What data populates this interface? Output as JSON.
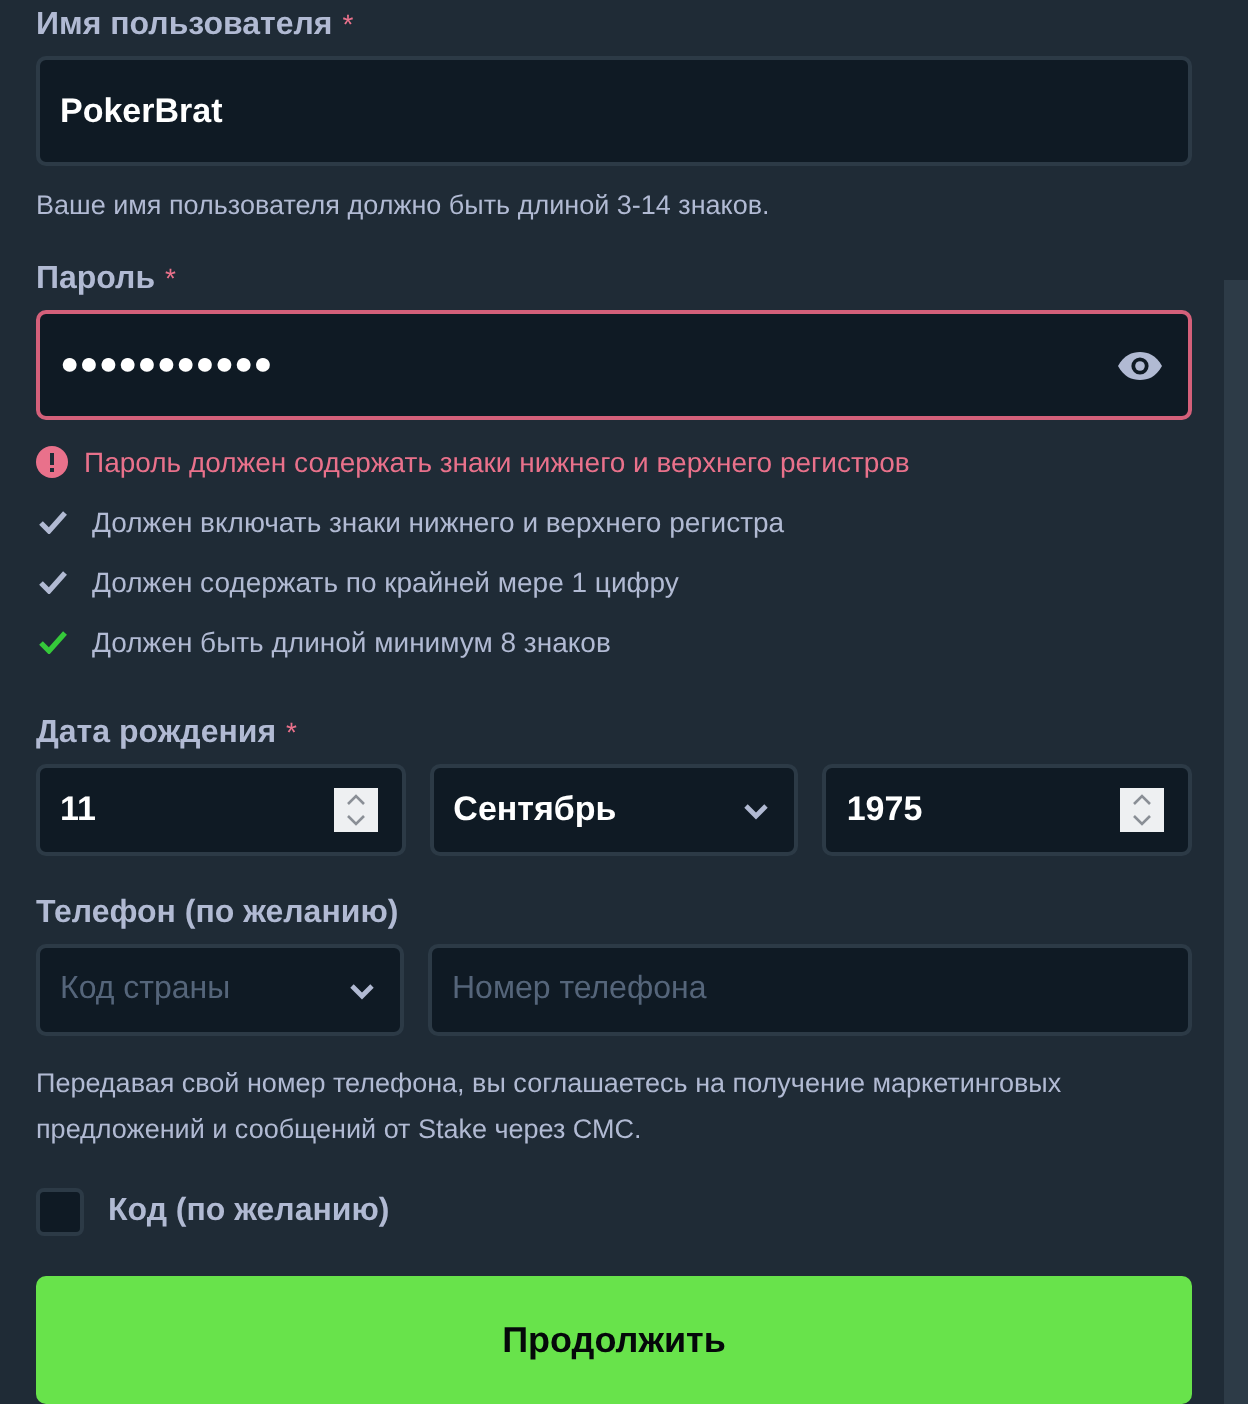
{
  "username": {
    "label": "Имя пользователя",
    "required_mark": "*",
    "value": "PokerBrat",
    "hint": "Ваше имя пользователя должно быть длиной 3-14 знаков."
  },
  "password": {
    "label": "Пароль",
    "required_mark": "*",
    "value": "●●●●●●●●●●●",
    "error": true,
    "error_text": "Пароль должен содержать знаки нижнего и верхнего регистров",
    "rules": [
      {
        "text": "Должен включать знаки нижнего и верхнего регистра",
        "met": false
      },
      {
        "text": "Должен содержать по крайней мере 1 цифру",
        "met": false
      },
      {
        "text": "Должен быть длиной минимум 8 знаков",
        "met": true
      }
    ]
  },
  "birthdate": {
    "label": "Дата рождения",
    "required_mark": "*",
    "fields": [
      {
        "kind": "number",
        "value": "11"
      },
      {
        "kind": "select",
        "value": "Сентябрь"
      },
      {
        "kind": "number",
        "value": "1975"
      }
    ]
  },
  "phone": {
    "label": "Телефон (по желанию)",
    "country": {
      "placeholder": "Код страны"
    },
    "number": {
      "placeholder": "Номер телефона"
    },
    "notice": "Передавая свой номер телефона, вы соглашаетесь на получение маркетинговых предложений и сообщений от Stake через СМС."
  },
  "code": {
    "label": "Код (по желанию)",
    "checked": false
  },
  "submit": "Продолжить"
}
